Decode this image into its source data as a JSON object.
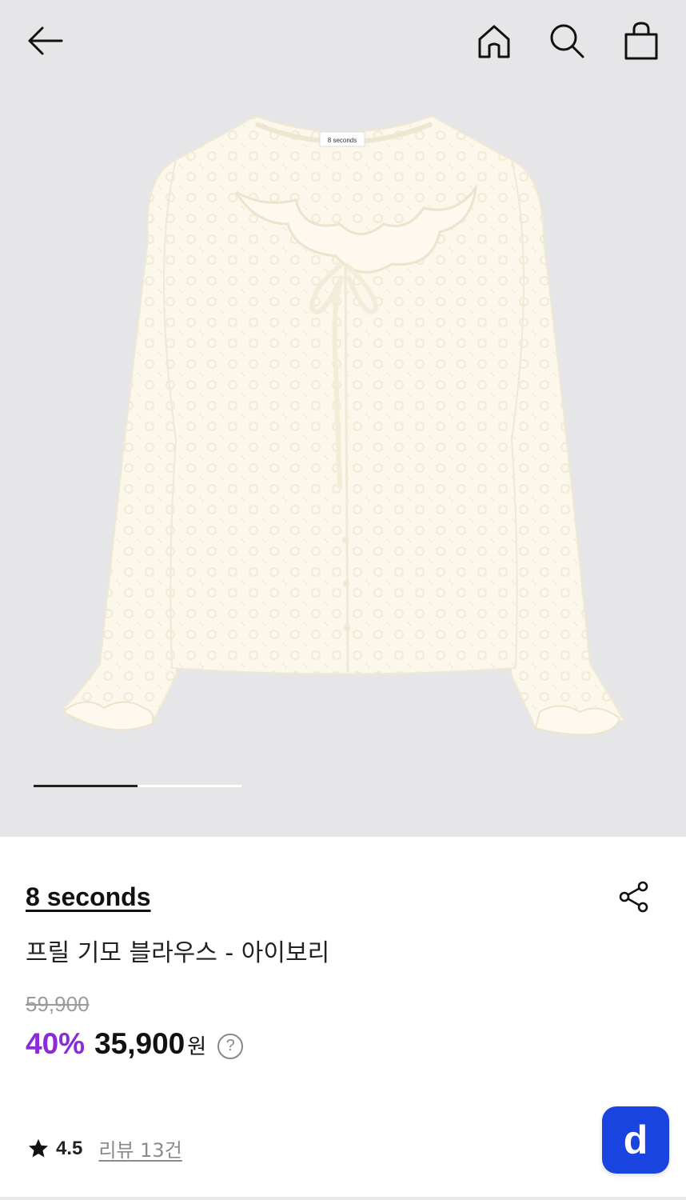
{
  "header": {
    "back_icon": "arrow-left-icon",
    "home_icon": "home-icon",
    "search_icon": "search-icon",
    "cart_icon": "shopping-bag-icon"
  },
  "gallery": {
    "label_tag": "8 seconds",
    "progress": 0.5,
    "background": "#e6e6e8"
  },
  "product": {
    "brand": "8 seconds",
    "title": "프릴 기모 블라우스 - 아이보리",
    "original_price": "59,900",
    "discount": "40%",
    "price": "35,900",
    "currency": "원",
    "help_icon": "?",
    "rating": "4.5",
    "reviews": "리뷰 13건"
  },
  "fab": {
    "label": "d",
    "color": "#1a44e0"
  },
  "colors": {
    "discount": "#8a2bd8",
    "brand_text": "#111111"
  }
}
